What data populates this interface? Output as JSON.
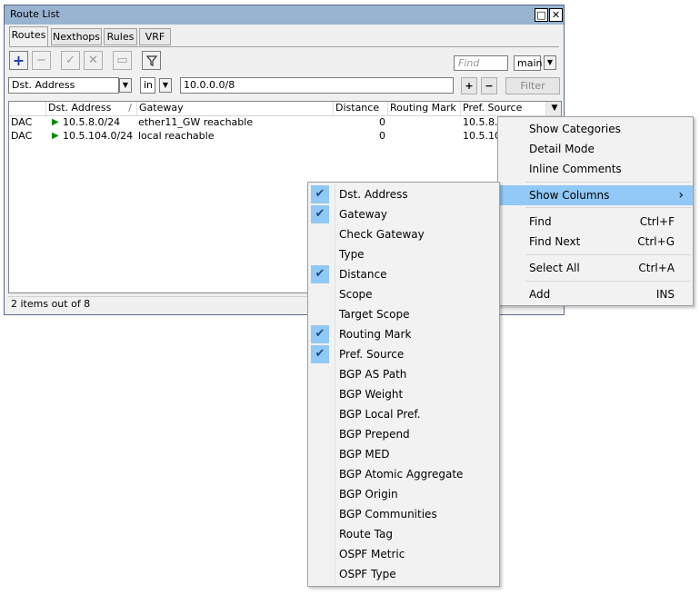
{
  "window": {
    "title": "Route List"
  },
  "tabs": [
    "Routes",
    "Nexthops",
    "Rules",
    "VRF"
  ],
  "toolbar": {
    "find_placeholder": "Find",
    "table_select": "main"
  },
  "filter": {
    "field": "Dst. Address",
    "operator": "in",
    "value": "10.0.0.0/8",
    "add_label": "+",
    "remove_label": "−",
    "filter_label": "Filter"
  },
  "columns": [
    "",
    "Dst. Address",
    "Gateway",
    "Distance",
    "Routing Mark",
    "Pref. Source"
  ],
  "sort_indicator": "/",
  "rows": [
    {
      "flags": "DAC",
      "dst": "10.5.8.0/24",
      "gateway": "ether11_GW reachable",
      "distance": "0",
      "mark": "",
      "pref": "10.5.8.1"
    },
    {
      "flags": "DAC",
      "dst": "10.5.104.0/24",
      "gateway": "local reachable",
      "distance": "0",
      "mark": "",
      "pref": "10.5.104"
    }
  ],
  "status": "2 items out of 8",
  "context_menu": {
    "items": [
      {
        "label": "Show Categories",
        "shortcut": ""
      },
      {
        "label": "Detail Mode",
        "shortcut": ""
      },
      {
        "label": "Inline Comments",
        "shortcut": ""
      },
      {
        "label": "Show Columns",
        "shortcut": "›"
      },
      {
        "label": "Find",
        "shortcut": "Ctrl+F"
      },
      {
        "label": "Find Next",
        "shortcut": "Ctrl+G"
      },
      {
        "label": "Select All",
        "shortcut": "Ctrl+A"
      },
      {
        "label": "Add",
        "shortcut": "INS"
      }
    ]
  },
  "columns_menu": {
    "items": [
      {
        "label": "Dst. Address",
        "checked": true
      },
      {
        "label": "Gateway",
        "checked": true
      },
      {
        "label": "Check Gateway",
        "checked": false
      },
      {
        "label": "Type",
        "checked": false
      },
      {
        "label": "Distance",
        "checked": true
      },
      {
        "label": "Scope",
        "checked": false
      },
      {
        "label": "Target Scope",
        "checked": false
      },
      {
        "label": "Routing Mark",
        "checked": true
      },
      {
        "label": "Pref. Source",
        "checked": true
      },
      {
        "label": "BGP AS Path",
        "checked": false
      },
      {
        "label": "BGP Weight",
        "checked": false
      },
      {
        "label": "BGP Local Pref.",
        "checked": false
      },
      {
        "label": "BGP Prepend",
        "checked": false
      },
      {
        "label": "BGP MED",
        "checked": false
      },
      {
        "label": "BGP Atomic Aggregate",
        "checked": false
      },
      {
        "label": "BGP Origin",
        "checked": false
      },
      {
        "label": "BGP Communities",
        "checked": false
      },
      {
        "label": "Route Tag",
        "checked": false
      },
      {
        "label": "OSPF Metric",
        "checked": false
      },
      {
        "label": "OSPF Type",
        "checked": false
      }
    ]
  }
}
